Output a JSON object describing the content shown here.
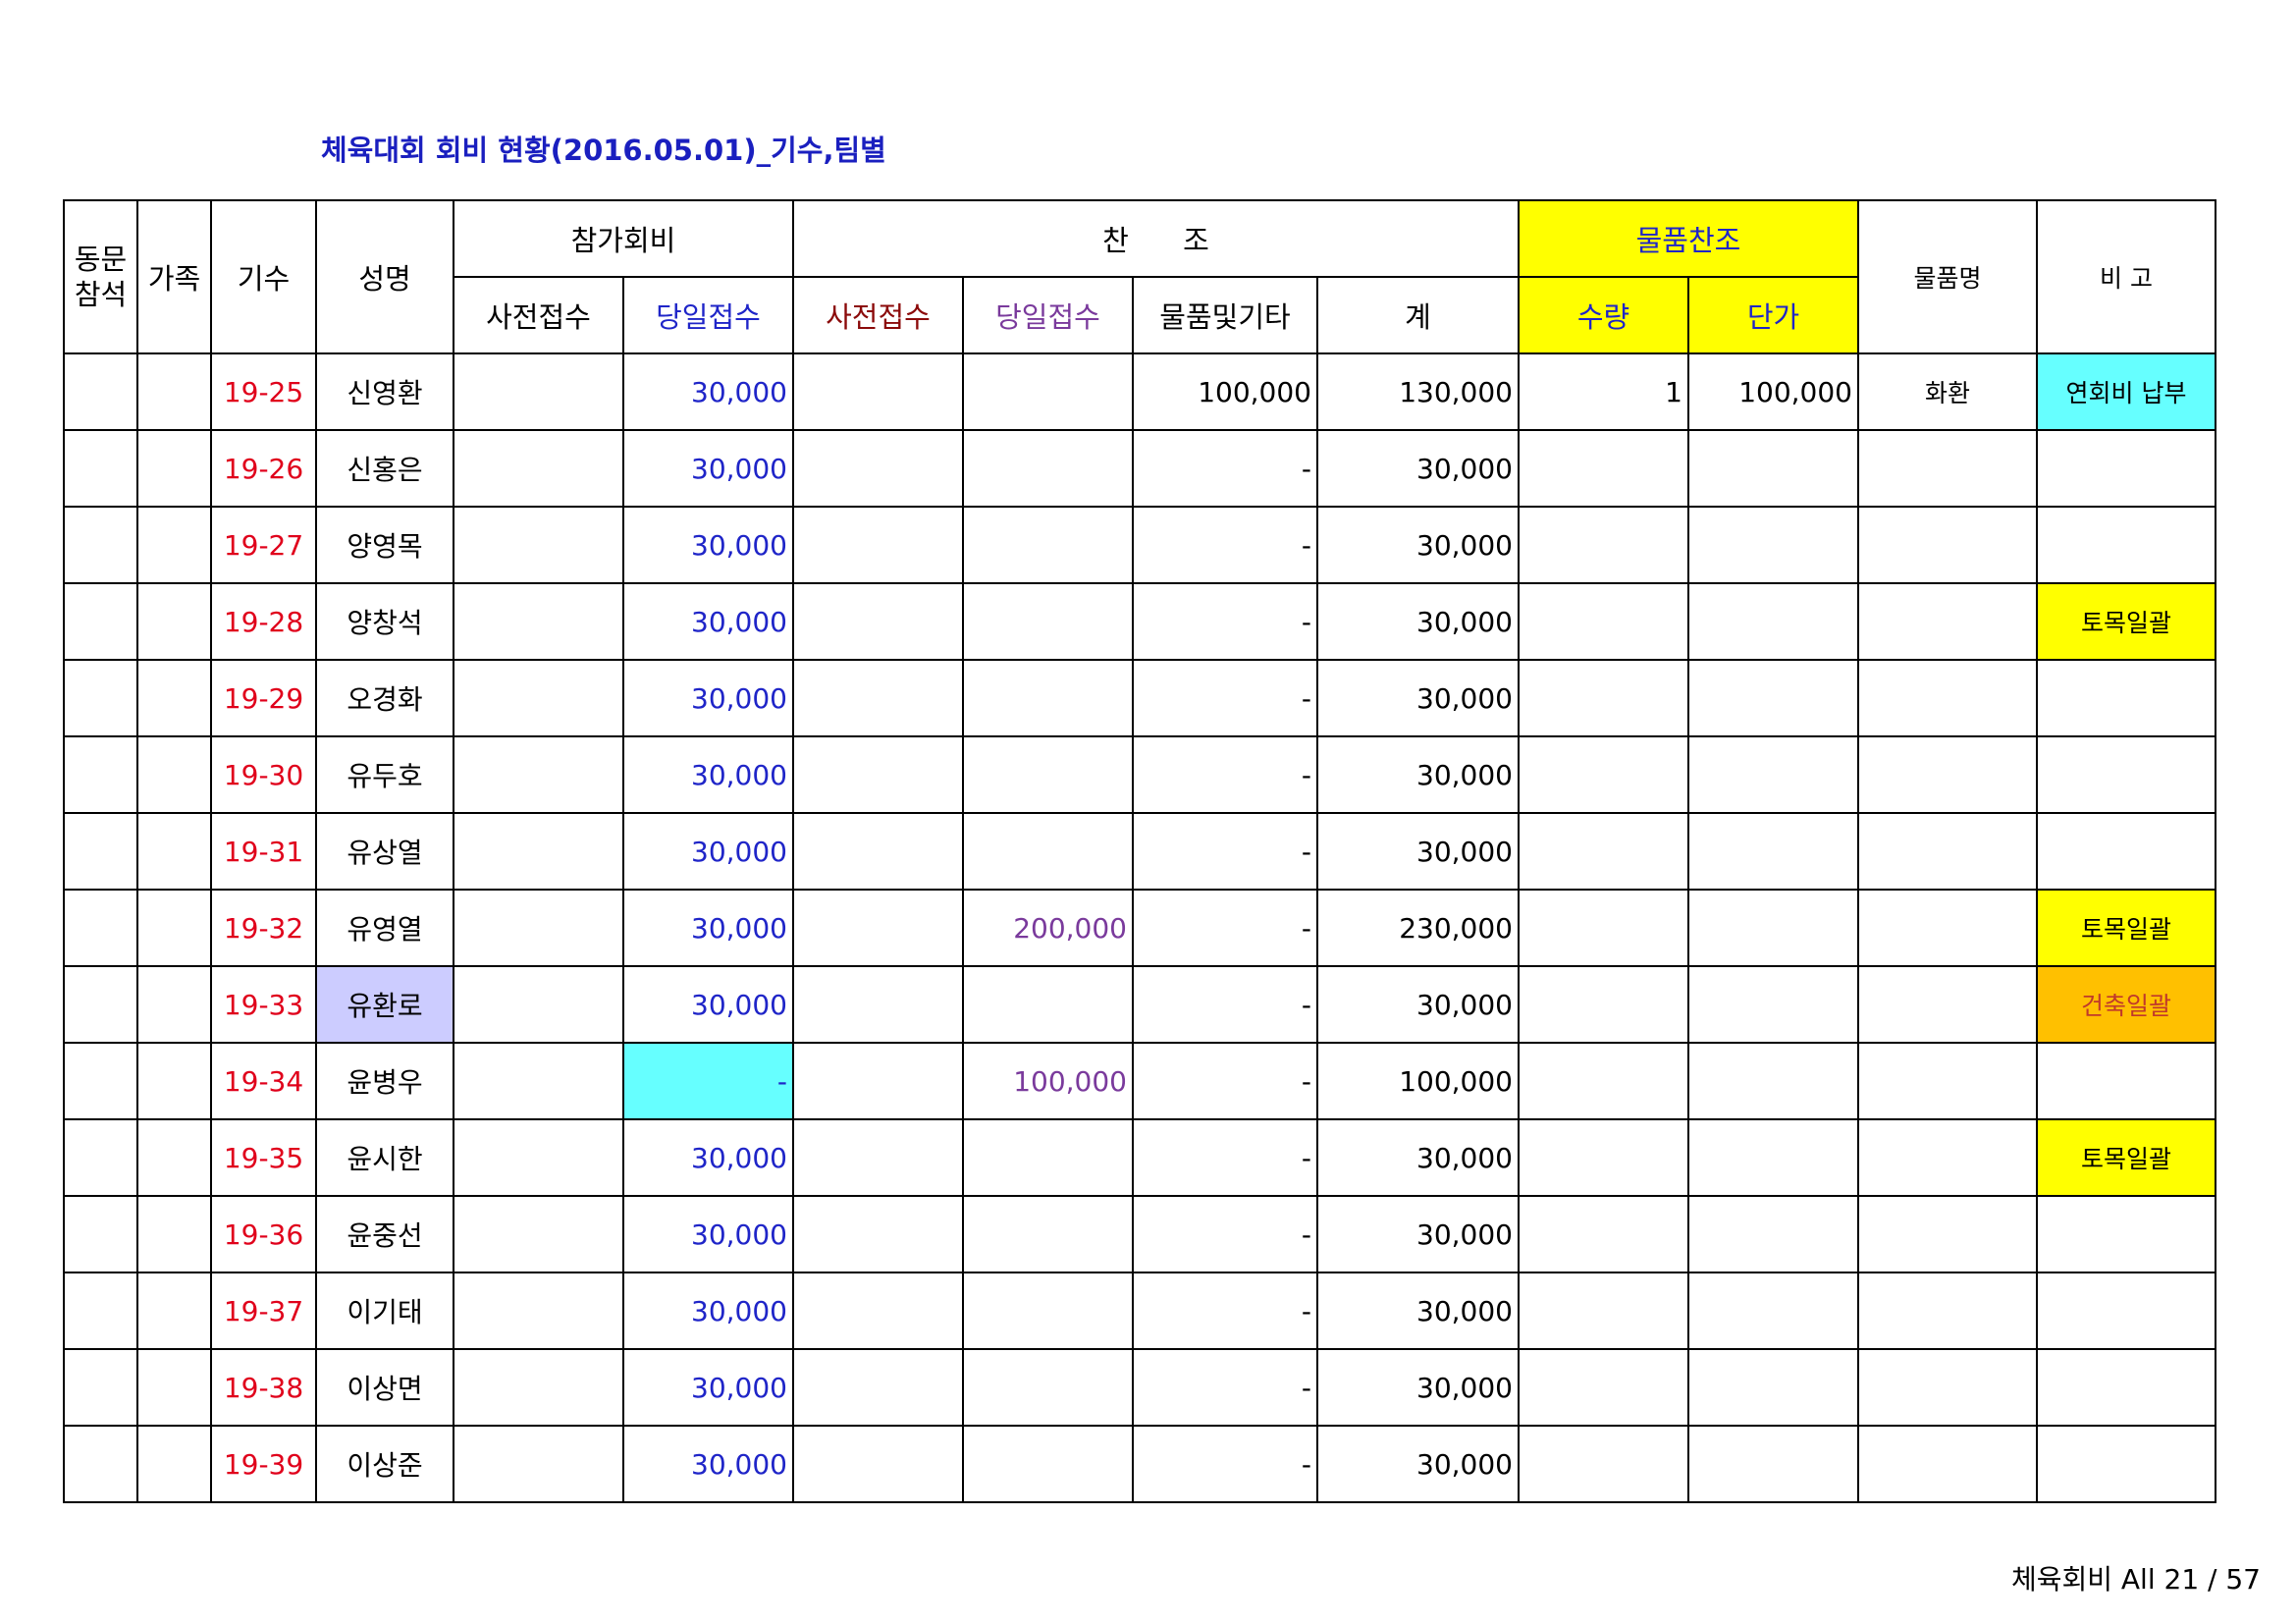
{
  "title": "체육대회 회비 현황(2016.05.01)_기수,팀별",
  "header": {
    "col_dongmun_line1": "동문",
    "col_dongmun_line2": "참석",
    "col_family": "가족",
    "col_gisu": "기수",
    "col_name": "성명",
    "group_fee": "참가회비",
    "group_sponsor": "찬      조",
    "group_goods": "물품찬조",
    "col_goods_name": "물품명",
    "col_note": "비 고",
    "sub_fee_pre": "사전접수",
    "sub_fee_day": "당일접수",
    "sub_spon_pre": "사전접수",
    "sub_spon_day": "당일접수",
    "sub_spon_goods": "물품및기타",
    "sub_spon_total": "계",
    "sub_qty": "수량",
    "sub_unit": "단가"
  },
  "rows": [
    {
      "gisu": "19-25",
      "name": "신영환",
      "fee_day": "30,000",
      "spon_day": "",
      "goods_etc": "100,000",
      "total": "130,000",
      "qty": "1",
      "unit": "100,000",
      "goods_name": "화환",
      "note": "연회비 납부"
    },
    {
      "gisu": "19-26",
      "name": "신홍은",
      "fee_day": "30,000",
      "spon_day": "",
      "goods_etc": "-",
      "total": "30,000",
      "qty": "",
      "unit": "",
      "goods_name": "",
      "note": ""
    },
    {
      "gisu": "19-27",
      "name": "양영목",
      "fee_day": "30,000",
      "spon_day": "",
      "goods_etc": "-",
      "total": "30,000",
      "qty": "",
      "unit": "",
      "goods_name": "",
      "note": ""
    },
    {
      "gisu": "19-28",
      "name": "양창석",
      "fee_day": "30,000",
      "spon_day": "",
      "goods_etc": "-",
      "total": "30,000",
      "qty": "",
      "unit": "",
      "goods_name": "",
      "note": "토목일괄"
    },
    {
      "gisu": "19-29",
      "name": "오경화",
      "fee_day": "30,000",
      "spon_day": "",
      "goods_etc": "-",
      "total": "30,000",
      "qty": "",
      "unit": "",
      "goods_name": "",
      "note": ""
    },
    {
      "gisu": "19-30",
      "name": "유두호",
      "fee_day": "30,000",
      "spon_day": "",
      "goods_etc": "-",
      "total": "30,000",
      "qty": "",
      "unit": "",
      "goods_name": "",
      "note": ""
    },
    {
      "gisu": "19-31",
      "name": "유상열",
      "fee_day": "30,000",
      "spon_day": "",
      "goods_etc": "-",
      "total": "30,000",
      "qty": "",
      "unit": "",
      "goods_name": "",
      "note": ""
    },
    {
      "gisu": "19-32",
      "name": "유영열",
      "fee_day": "30,000",
      "spon_day": "200,000",
      "goods_etc": "-",
      "total": "230,000",
      "qty": "",
      "unit": "",
      "goods_name": "",
      "note": "토목일괄"
    },
    {
      "gisu": "19-33",
      "name": "유환로",
      "fee_day": "30,000",
      "spon_day": "",
      "goods_etc": "-",
      "total": "30,000",
      "qty": "",
      "unit": "",
      "goods_name": "",
      "note": "건축일괄"
    },
    {
      "gisu": "19-34",
      "name": "윤병우",
      "fee_day": "-",
      "spon_day": "100,000",
      "goods_etc": "-",
      "total": "100,000",
      "qty": "",
      "unit": "",
      "goods_name": "",
      "note": ""
    },
    {
      "gisu": "19-35",
      "name": "윤시한",
      "fee_day": "30,000",
      "spon_day": "",
      "goods_etc": "-",
      "total": "30,000",
      "qty": "",
      "unit": "",
      "goods_name": "",
      "note": "토목일괄"
    },
    {
      "gisu": "19-36",
      "name": "윤중선",
      "fee_day": "30,000",
      "spon_day": "",
      "goods_etc": "-",
      "total": "30,000",
      "qty": "",
      "unit": "",
      "goods_name": "",
      "note": ""
    },
    {
      "gisu": "19-37",
      "name": "이기태",
      "fee_day": "30,000",
      "spon_day": "",
      "goods_etc": "-",
      "total": "30,000",
      "qty": "",
      "unit": "",
      "goods_name": "",
      "note": ""
    },
    {
      "gisu": "19-38",
      "name": "이상면",
      "fee_day": "30,000",
      "spon_day": "",
      "goods_etc": "-",
      "total": "30,000",
      "qty": "",
      "unit": "",
      "goods_name": "",
      "note": ""
    },
    {
      "gisu": "19-39",
      "name": "이상준",
      "fee_day": "30,000",
      "spon_day": "",
      "goods_etc": "-",
      "total": "30,000",
      "qty": "",
      "unit": "",
      "goods_name": "",
      "note": ""
    }
  ],
  "footer": "체육회비 All 21 / 57",
  "colors": {
    "title_blue": "#1a1fbf",
    "gisu_red": "#e0001b",
    "fee_blue": "#1f25c8",
    "sponsor_pre_darkred": "#8b0a0a",
    "sponsor_day_purple": "#7a3a9c",
    "highlight_yellow": "#ffff00",
    "highlight_cyan": "#66ffff",
    "highlight_lavender": "#ccccff",
    "highlight_orange": "#ffc000"
  }
}
